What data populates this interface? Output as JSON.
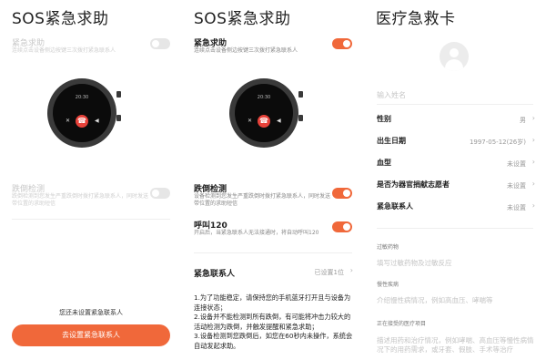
{
  "panel1": {
    "title": "SOS紧急求助",
    "sos": {
      "label": "紧急求助",
      "desc": "连续点击设备侧边按键三次拨打紧急联系人",
      "enabled": false
    },
    "watch_time": "20:30",
    "fall": {
      "label": "跌倒检测",
      "desc": "跌倒检测到您发生严重跌倒时拨打紧急联系人，同时发送带位置的求助短信",
      "enabled": false
    },
    "notice": "您还未设置紧急联系人",
    "cta": "去设置紧急联系人"
  },
  "panel2": {
    "title": "SOS紧急求助",
    "sos": {
      "label": "紧急求助",
      "desc": "连续点击设备侧边按键三次拨打紧急联系人",
      "enabled": true
    },
    "watch_time": "20:30",
    "fall": {
      "label": "跌倒检测",
      "desc": "设备检测到您发生严重跌倒时拨打紧急联系人，同时发送带位置的求助短信",
      "enabled": true
    },
    "call120": {
      "label": "呼叫120",
      "desc": "开启后，当紧急联系人无法接通时，将自动呼叫120",
      "enabled": true
    },
    "contacts": {
      "label": "紧急联系人",
      "value": "已设置1位"
    },
    "tips": [
      "1.为了功能稳定，请保持您的手机蓝牙打开且与设备为连接状态；",
      "2.设备并不能检测到所有跌倒，有可能将冲击力较大的活动检测为跌倒，并触发提醒和紧急求助；",
      "3.设备检测到您跌倒后，如您在60秒内未操作，系统会自动发起求助。"
    ]
  },
  "panel3": {
    "title": "医疗急救卡",
    "name_placeholder": "输入姓名",
    "fields": [
      {
        "label": "性别",
        "value": "男"
      },
      {
        "label": "出生日期",
        "value": "1997-05-12(26岁)"
      },
      {
        "label": "血型",
        "value": "未设置"
      },
      {
        "label": "是否为器官捐献志愿者",
        "value": "未设置"
      },
      {
        "label": "紧急联系人",
        "value": "未设置"
      }
    ],
    "allergy": {
      "title": "过敏药物",
      "hint": "填写过敏药物及过敏反应"
    },
    "chronic": {
      "title": "慢性疾病",
      "hint": "介绍慢性病情况，例如高血压、哮喘等"
    },
    "treatment": {
      "title": "正在接受的医疗项目",
      "hint": "描述用药和治疗情况，例如哮喘、高血压等慢性病情况下的用药需求，或牙套、假肢、手术等治疗"
    }
  },
  "colors": {
    "accent": "#f0683a",
    "toggle_off": "#e6e6e6",
    "text": "#222222",
    "muted": "#999999"
  }
}
